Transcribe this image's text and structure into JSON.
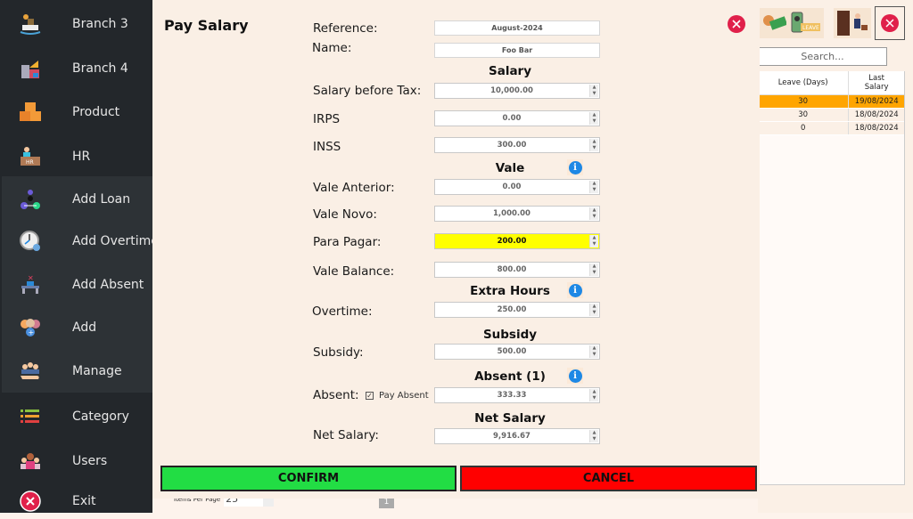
{
  "sidebar": {
    "items": [
      {
        "label": "Branch 3",
        "icon": "ship-icon"
      },
      {
        "label": "Branch 4",
        "icon": "warehouse-icon"
      },
      {
        "label": "Product",
        "icon": "boxes-icon"
      },
      {
        "label": "HR",
        "icon": "hr-desk-icon"
      },
      {
        "label": "Add Loan",
        "icon": "loan-icon"
      },
      {
        "label": "Add Overtime",
        "icon": "clock-icon"
      },
      {
        "label": "Add Absent",
        "icon": "absent-desk-icon"
      },
      {
        "label": "Add",
        "icon": "add-people-icon"
      },
      {
        "label": "Manage",
        "icon": "manage-people-icon"
      },
      {
        "label": "Category",
        "icon": "list-icon"
      },
      {
        "label": "Users",
        "icon": "users-icon"
      },
      {
        "label": "Exit",
        "icon": "exit-icon"
      }
    ]
  },
  "background": {
    "search_placeholder": "Search...",
    "table": {
      "headers": [
        "Leave (Days)",
        "Last Salary"
      ],
      "rows": [
        {
          "leave": "30",
          "last_salary": "19/08/2024",
          "selected": true
        },
        {
          "leave": "30",
          "last_salary": "18/08/2024",
          "selected": false
        },
        {
          "leave": "0",
          "last_salary": "18/08/2024",
          "selected": false
        }
      ]
    },
    "items_per_page_label": "Items Per Page",
    "items_per_page_value": "25",
    "page": "1",
    "toolbar_icons": [
      "pay-money-icon",
      "leave-icon",
      "exit-door-icon",
      "close-icon"
    ]
  },
  "dialog": {
    "title": "Pay Salary",
    "reference_label": "Reference:",
    "reference_value": "August-2024",
    "name_label": "Name:",
    "name_value": "Foo Bar",
    "sections": {
      "salary": "Salary",
      "vale": "Vale",
      "extra_hours": "Extra Hours",
      "subsidy": "Subsidy",
      "absent": "Absent (1)",
      "net_salary": "Net Salary"
    },
    "fields": {
      "salary_before_tax": {
        "label": "Salary before Tax:",
        "value": "10,000.00"
      },
      "irps": {
        "label": "IRPS",
        "value": "0.00"
      },
      "inss": {
        "label": "INSS",
        "value": "300.00"
      },
      "vale_anterior": {
        "label": "Vale Anterior:",
        "value": "0.00"
      },
      "vale_novo": {
        "label": "Vale Novo:",
        "value": "1,000.00"
      },
      "para_pagar": {
        "label": "Para Pagar:",
        "value": "200.00"
      },
      "vale_balance": {
        "label": "Vale Balance:",
        "value": "800.00"
      },
      "overtime": {
        "label": "Overtime:",
        "value": "250.00"
      },
      "subsidy": {
        "label": "Subsidy:",
        "value": "500.00"
      },
      "absent": {
        "label": "Absent:",
        "value": "333.33"
      },
      "net_salary": {
        "label": "Net Salary:",
        "value": "9,916.67"
      }
    },
    "pay_absent_label": "Pay Absent",
    "pay_absent_checked": true,
    "confirm_label": "CONFIRM",
    "cancel_label": "CANCEL",
    "colors": {
      "highlight": "#ffff00",
      "confirm": "#22dd44",
      "cancel": "#ff0000",
      "selected_row": "#ffa500"
    }
  }
}
